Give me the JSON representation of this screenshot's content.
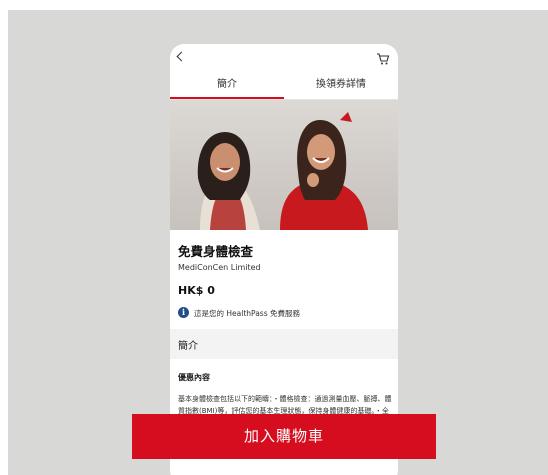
{
  "tabs": [
    {
      "label": "簡介",
      "active": true
    },
    {
      "label": "換領券詳情",
      "active": false
    }
  ],
  "icons": {
    "back": "chevron-left-icon",
    "cart": "cart-icon",
    "info": "info-icon"
  },
  "product": {
    "title": "免費身體檢查",
    "vendor": "MediConCen Limited",
    "price": "HK$ 0",
    "info_icon_glyph": "i",
    "info_text": "這是您的 HealthPass 免費服務"
  },
  "section": {
    "title": "簡介",
    "sub_heading": "優惠內容",
    "body": "基本身體檢查包括以下的範疇：・體格檢查：通過測量血壓、脈搏、體質指數(BMI)等，評估您的基本生理狀態，保持身體健康的基礎。・全面血液分析(CBC)：深入分析血"
  },
  "cta": {
    "label": "加入購物車"
  },
  "colors": {
    "accent": "#d50d1f",
    "info": "#1f4f86",
    "backdrop": "#d8d8d7"
  }
}
